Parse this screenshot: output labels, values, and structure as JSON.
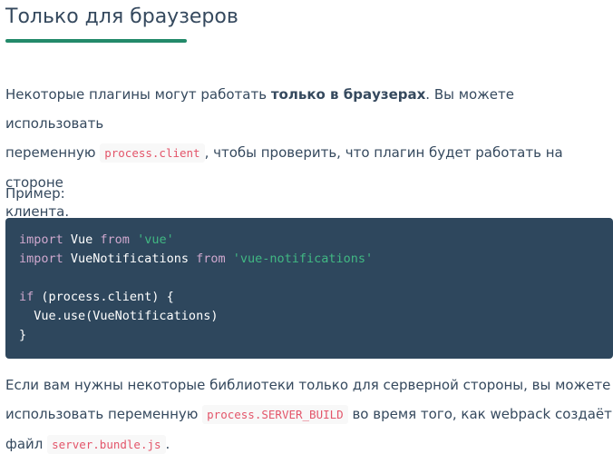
{
  "heading": {
    "title": "Только для браузеров"
  },
  "intro": {
    "text_1": "Некоторые плагины могут работать ",
    "strong": "только в браузерах",
    "text_2": ". Вы можете использовать",
    "text_3": "переменную ",
    "code": "process.client",
    "text_4": ", чтобы проверить, что плагин будет работать на стороне",
    "text_5": "клиента."
  },
  "example_label": "Пример:",
  "code_block": {
    "lines": [
      [
        {
          "t": "kw",
          "v": "import"
        },
        {
          "t": "plain",
          "v": " Vue "
        },
        {
          "t": "kw",
          "v": "from"
        },
        {
          "t": "plain",
          "v": " "
        },
        {
          "t": "str",
          "v": "'vue'"
        }
      ],
      [
        {
          "t": "kw",
          "v": "import"
        },
        {
          "t": "plain",
          "v": " VueNotifications "
        },
        {
          "t": "kw",
          "v": "from"
        },
        {
          "t": "plain",
          "v": " "
        },
        {
          "t": "str",
          "v": "'vue-notifications'"
        }
      ],
      [],
      [
        {
          "t": "kw",
          "v": "if"
        },
        {
          "t": "plain",
          "v": " (process.client) {"
        }
      ],
      [
        {
          "t": "plain",
          "v": "  Vue.use(VueNotifications)"
        }
      ],
      [
        {
          "t": "plain",
          "v": "}"
        }
      ]
    ]
  },
  "server": {
    "text_1": "Если вам нужны некоторые библиотеки только для серверной стороны, вы можете",
    "text_2": "использовать переменную ",
    "code_1": "process.SERVER_BUILD",
    "text_3": " во время того, как ",
    "webpack": "webpack",
    "text_4": " создаёт",
    "text_5": "файл ",
    "code_2": "server.bundle.js",
    "text_6": "."
  },
  "colors": {
    "text": "#35495e",
    "accent_green": "#238a6a",
    "code_bg": "#2e475d",
    "keyword": "#cfa8ce",
    "string": "#41b883",
    "inline_code": "#e3556a"
  }
}
